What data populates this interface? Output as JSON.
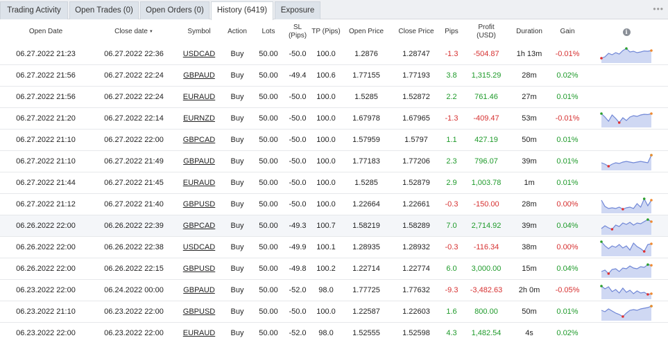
{
  "tabs": [
    {
      "label": "Trading Activity",
      "name": "tab-trading-activity",
      "active": false
    },
    {
      "label": "Open Trades (0)",
      "name": "tab-open-trades",
      "active": false
    },
    {
      "label": "Open Orders (0)",
      "name": "tab-open-orders",
      "active": false
    },
    {
      "label": "History (6419)",
      "name": "tab-history",
      "active": true
    },
    {
      "label": "Exposure",
      "name": "tab-exposure",
      "active": false
    }
  ],
  "menu_glyph": "•••",
  "columns": {
    "open_date": "Open Date",
    "close_date": "Close date",
    "symbol": "Symbol",
    "action": "Action",
    "lots": "Lots",
    "sl": "SL (Pips)",
    "tp": "TP (Pips)",
    "open_price": "Open Price",
    "close_price": "Close Price",
    "pips": "Pips",
    "profit": "Profit (USD)",
    "duration": "Duration",
    "gain": "Gain",
    "info_glyph": "i"
  },
  "sort_indicator": "▼",
  "colors": {
    "negative": "#d63030",
    "positive": "#1e9a2a",
    "spark_fill": "#cfd8f3",
    "spark_line": "#6f86d6"
  },
  "rows": [
    {
      "open": "06.27.2022 21:23",
      "close": "06.27.2022 22:36",
      "symbol": "USDCAD",
      "action": "Buy",
      "lots": "50.00",
      "sl": "-50.0",
      "tp": "100.0",
      "op": "1.2876",
      "cp": "1.28747",
      "pips": "-1.3",
      "profit": "-504.87",
      "duration": "1h 13m",
      "gain": "-0.01%",
      "sign": "neg",
      "spark": [
        0.2,
        0.3,
        0.55,
        0.45,
        0.6,
        0.5,
        0.75,
        0.9,
        0.65,
        0.7,
        0.6,
        0.65,
        0.72,
        0.7,
        0.75
      ]
    },
    {
      "open": "06.27.2022 21:56",
      "close": "06.27.2022 22:24",
      "symbol": "GBPAUD",
      "action": "Buy",
      "lots": "50.00",
      "sl": "-49.4",
      "tp": "100.6",
      "op": "1.77155",
      "cp": "1.77193",
      "pips": "3.8",
      "profit": "1,315.29",
      "duration": "28m",
      "gain": "0.02%",
      "sign": "pos",
      "spark": null
    },
    {
      "open": "06.27.2022 21:56",
      "close": "06.27.2022 22:24",
      "symbol": "EURAUD",
      "action": "Buy",
      "lots": "50.00",
      "sl": "-50.0",
      "tp": "100.0",
      "op": "1.5285",
      "cp": "1.52872",
      "pips": "2.2",
      "profit": "761.46",
      "duration": "27m",
      "gain": "0.01%",
      "sign": "pos",
      "spark": null
    },
    {
      "open": "06.27.2022 21:20",
      "close": "06.27.2022 22:14",
      "symbol": "EURNZD",
      "action": "Buy",
      "lots": "50.00",
      "sl": "-50.0",
      "tp": "100.0",
      "op": "1.67978",
      "cp": "1.67965",
      "pips": "-1.3",
      "profit": "-409.47",
      "duration": "53m",
      "gain": "-0.01%",
      "sign": "neg",
      "spark": [
        0.85,
        0.6,
        0.3,
        0.75,
        0.5,
        0.2,
        0.55,
        0.35,
        0.6,
        0.7,
        0.65,
        0.75,
        0.8,
        0.78,
        0.85
      ]
    },
    {
      "open": "06.27.2022 21:10",
      "close": "06.27.2022 22:00",
      "symbol": "GBPCAD",
      "action": "Buy",
      "lots": "50.00",
      "sl": "-50.0",
      "tp": "100.0",
      "op": "1.57959",
      "cp": "1.5797",
      "pips": "1.1",
      "profit": "427.19",
      "duration": "50m",
      "gain": "0.01%",
      "sign": "pos",
      "spark": null
    },
    {
      "open": "06.27.2022 21:10",
      "close": "06.27.2022 21:49",
      "symbol": "GBPAUD",
      "action": "Buy",
      "lots": "50.00",
      "sl": "-50.0",
      "tp": "100.0",
      "op": "1.77183",
      "cp": "1.77206",
      "pips": "2.3",
      "profit": "796.07",
      "duration": "39m",
      "gain": "0.01%",
      "sign": "pos",
      "spark": [
        0.4,
        0.3,
        0.15,
        0.3,
        0.4,
        0.35,
        0.45,
        0.5,
        0.45,
        0.4,
        0.45,
        0.5,
        0.45,
        0.4,
        0.95
      ]
    },
    {
      "open": "06.27.2022 21:44",
      "close": "06.27.2022 21:45",
      "symbol": "EURAUD",
      "action": "Buy",
      "lots": "50.00",
      "sl": "-50.0",
      "tp": "100.0",
      "op": "1.5285",
      "cp": "1.52879",
      "pips": "2.9",
      "profit": "1,003.78",
      "duration": "1m",
      "gain": "0.01%",
      "sign": "pos",
      "spark": null
    },
    {
      "open": "06.27.2022 21:12",
      "close": "06.27.2022 21:40",
      "symbol": "GBPUSD",
      "action": "Buy",
      "lots": "50.00",
      "sl": "-50.0",
      "tp": "100.0",
      "op": "1.22664",
      "cp": "1.22661",
      "pips": "-0.3",
      "profit": "-150.00",
      "duration": "28m",
      "gain": "0.00%",
      "sign": "neg",
      "spark": [
        0.8,
        0.35,
        0.2,
        0.25,
        0.2,
        0.3,
        0.15,
        0.25,
        0.3,
        0.2,
        0.55,
        0.3,
        0.9,
        0.4,
        0.8
      ]
    },
    {
      "open": "06.26.2022 22:00",
      "close": "06.26.2022 22:39",
      "symbol": "GBPCAD",
      "action": "Buy",
      "lots": "50.00",
      "sl": "-49.3",
      "tp": "100.7",
      "op": "1.58219",
      "cp": "1.58289",
      "pips": "7.0",
      "profit": "2,714.92",
      "duration": "39m",
      "gain": "0.04%",
      "sign": "pos",
      "spark": [
        0.3,
        0.5,
        0.35,
        0.25,
        0.55,
        0.45,
        0.7,
        0.6,
        0.75,
        0.55,
        0.7,
        0.65,
        0.8,
        0.95,
        0.8
      ]
    },
    {
      "open": "06.26.2022 22:00",
      "close": "06.26.2022 22:38",
      "symbol": "USDCAD",
      "action": "Buy",
      "lots": "50.00",
      "sl": "-49.9",
      "tp": "100.1",
      "op": "1.28935",
      "cp": "1.28932",
      "pips": "-0.3",
      "profit": "-116.34",
      "duration": "38m",
      "gain": "0.00%",
      "sign": "neg",
      "spark": [
        0.9,
        0.6,
        0.4,
        0.6,
        0.5,
        0.7,
        0.45,
        0.6,
        0.3,
        0.8,
        0.55,
        0.4,
        0.2,
        0.7,
        0.75
      ]
    },
    {
      "open": "06.26.2022 22:00",
      "close": "06.26.2022 22:15",
      "symbol": "GBPUSD",
      "action": "Buy",
      "lots": "50.00",
      "sl": "-49.8",
      "tp": "100.2",
      "op": "1.22714",
      "cp": "1.22774",
      "pips": "6.0",
      "profit": "3,000.00",
      "duration": "15m",
      "gain": "0.04%",
      "sign": "pos",
      "spark": [
        0.3,
        0.4,
        0.15,
        0.45,
        0.5,
        0.3,
        0.55,
        0.5,
        0.7,
        0.55,
        0.5,
        0.65,
        0.6,
        0.8,
        0.75
      ]
    },
    {
      "open": "06.23.2022 22:00",
      "close": "06.24.2022 00:00",
      "symbol": "GBPAUD",
      "action": "Buy",
      "lots": "50.00",
      "sl": "-52.0",
      "tp": "98.0",
      "op": "1.77725",
      "cp": "1.77632",
      "pips": "-9.3",
      "profit": "-3,482.63",
      "duration": "2h 0m",
      "gain": "-0.05%",
      "sign": "neg",
      "spark": [
        0.8,
        0.6,
        0.75,
        0.4,
        0.55,
        0.3,
        0.65,
        0.35,
        0.5,
        0.25,
        0.45,
        0.3,
        0.35,
        0.2,
        0.25
      ]
    },
    {
      "open": "06.23.2022 21:10",
      "close": "06.23.2022 22:00",
      "symbol": "GBPUSD",
      "action": "Buy",
      "lots": "50.00",
      "sl": "-50.0",
      "tp": "100.0",
      "op": "1.22587",
      "cp": "1.22603",
      "pips": "1.6",
      "profit": "800.00",
      "duration": "50m",
      "gain": "0.01%",
      "sign": "pos",
      "spark": [
        0.6,
        0.5,
        0.7,
        0.55,
        0.4,
        0.3,
        0.15,
        0.4,
        0.6,
        0.65,
        0.6,
        0.7,
        0.75,
        0.8,
        0.9
      ]
    },
    {
      "open": "06.23.2022 22:00",
      "close": "06.23.2022 22:00",
      "symbol": "EURAUD",
      "action": "Buy",
      "lots": "50.00",
      "sl": "-52.0",
      "tp": "98.0",
      "op": "1.52555",
      "cp": "1.52598",
      "pips": "4.3",
      "profit": "1,482.54",
      "duration": "4s",
      "gain": "0.02%",
      "sign": "pos",
      "spark": null
    }
  ]
}
